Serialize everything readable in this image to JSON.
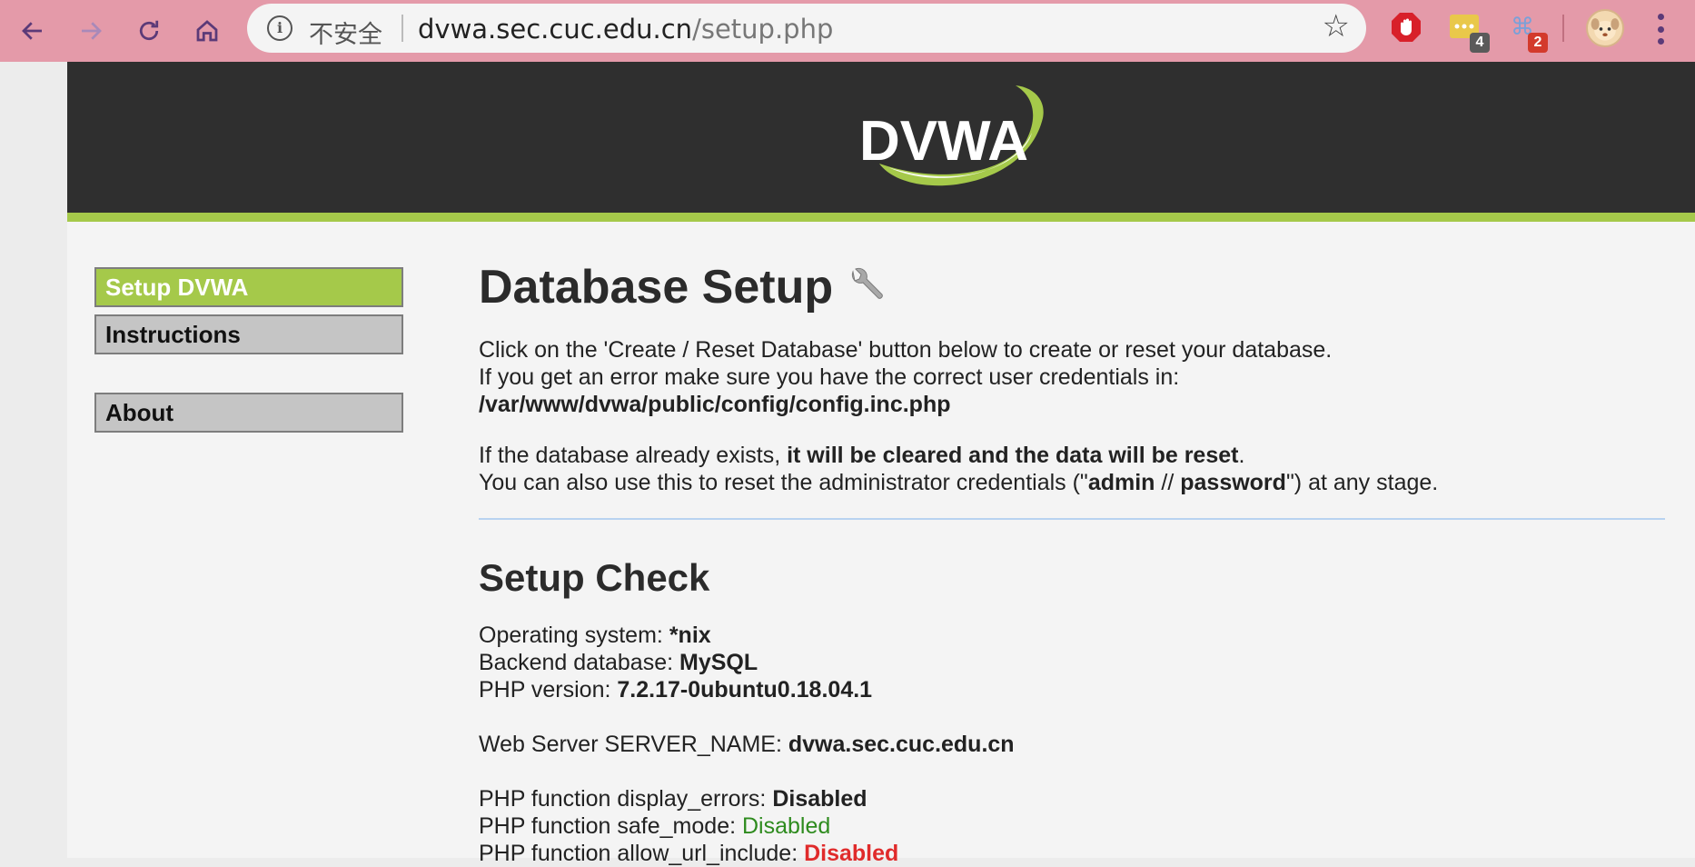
{
  "browser": {
    "security_label": "不安全",
    "url_host": "dvwa.sec.cuc.edu.cn",
    "url_path": "/setup.php",
    "extensions": [
      {
        "name": "adblock-icon",
        "badge": ""
      },
      {
        "name": "password-manager-icon",
        "badge": "4"
      },
      {
        "name": "shortcut-extension-icon",
        "badge": "2"
      }
    ]
  },
  "header": {
    "logo_text": "DVWA",
    "accent_color": "#a5c94a"
  },
  "sidebar": {
    "items": [
      {
        "label": "Setup DVWA",
        "selected": true
      },
      {
        "label": "Instructions",
        "selected": false
      },
      {
        "label": "About",
        "selected": false
      }
    ]
  },
  "main": {
    "title": "Database Setup",
    "intro_line1": "Click on the 'Create / Reset Database' button below to create or reset your database.",
    "intro_line2": "If you get an error make sure you have the correct user credentials in:",
    "config_path": "/var/www/dvwa/public/config/config.inc.php",
    "exists_prefix": "If the database already exists, ",
    "exists_bold": "it will be cleared and the data will be reset",
    "exists_suffix": ".",
    "reset_prefix": "You can also use this to reset the administrator credentials (\"",
    "reset_admin": "admin",
    "reset_sep": " // ",
    "reset_password": "password",
    "reset_suffix": "\") at any stage.",
    "check_title": "Setup Check",
    "checks": {
      "os_label": "Operating system: ",
      "os_value": "*nix",
      "db_label": "Backend database: ",
      "db_value": "MySQL",
      "php_label": "PHP version: ",
      "php_value": "7.2.17-0ubuntu0.18.04.1",
      "server_label": "Web Server SERVER_NAME: ",
      "server_value": "dvwa.sec.cuc.edu.cn",
      "display_errors_label": "PHP function display_errors: ",
      "display_errors_value": "Disabled",
      "safe_mode_label": "PHP function safe_mode: ",
      "safe_mode_value": "Disabled",
      "allow_url_include_label": "PHP function allow_url_include: ",
      "allow_url_include_value": "Disabled"
    }
  }
}
